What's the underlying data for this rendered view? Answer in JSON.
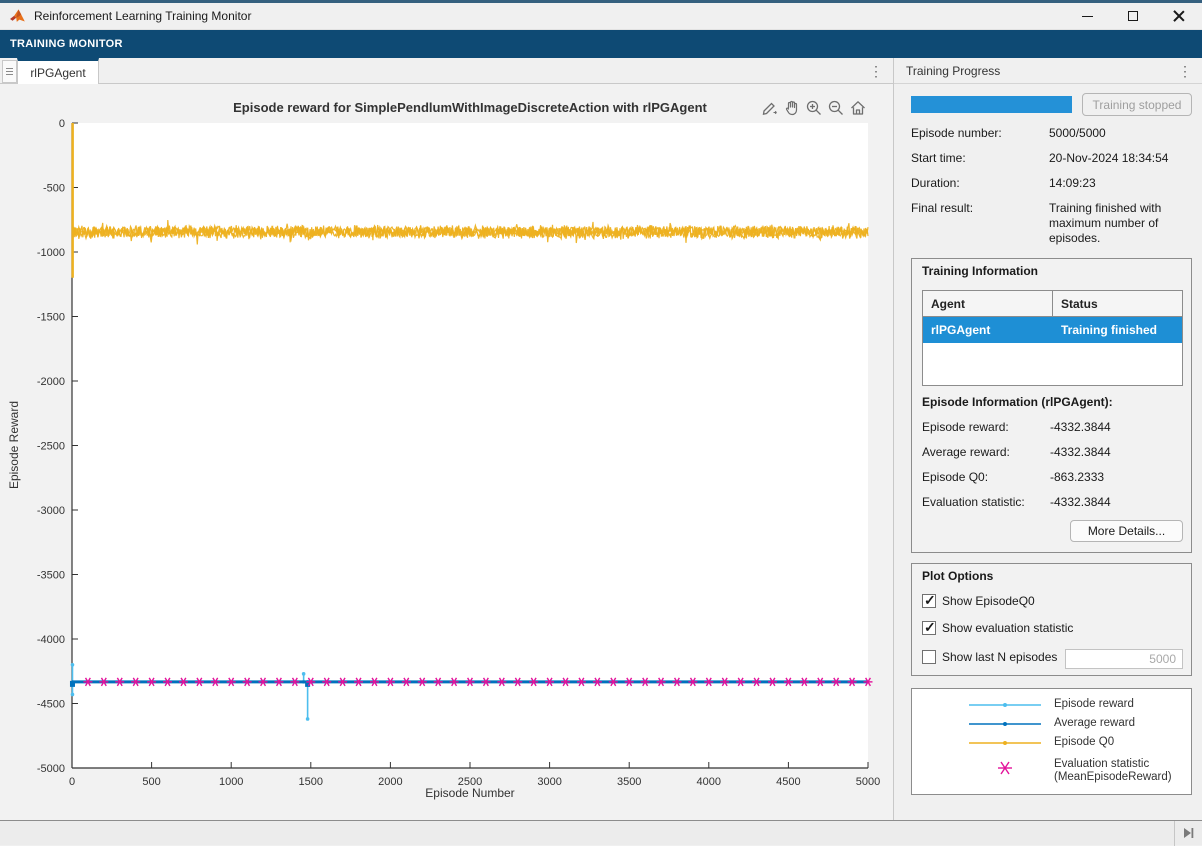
{
  "window": {
    "title": "Reinforcement Learning Training Monitor"
  },
  "toolstrip": {
    "tab_label": "TRAINING MONITOR"
  },
  "doc_tab": {
    "label": "rlPGAgent"
  },
  "colors": {
    "toolstrip_blue": "#0e4a74",
    "selection_blue": "#1e8fd5",
    "progress_blue": "#2491d7",
    "episode_reward": "#4DBEEE",
    "average_reward": "#0072BD",
    "episode_q0": "#EDB120",
    "evaluation_statistic": "#E3129B"
  },
  "panel": {
    "title": "Training Progress",
    "progress": {
      "percent": 100,
      "button_label": "Training stopped"
    },
    "rows": [
      {
        "label": "Episode number:",
        "value": "5000/5000"
      },
      {
        "label": "Start time:",
        "value": "20-Nov-2024 18:34:54"
      },
      {
        "label": "Duration:",
        "value": "14:09:23"
      },
      {
        "label": "Final result:",
        "value": "Training finished with maximum number of episodes."
      }
    ],
    "training_information": {
      "title": "Training Information",
      "table": {
        "headers": [
          "Agent",
          "Status"
        ],
        "rows": [
          {
            "agent": "rlPGAgent",
            "status": "Training finished",
            "selected": true
          }
        ]
      },
      "episode_info_title": "Episode Information (rlPGAgent):",
      "rows": [
        {
          "label": "Episode reward:",
          "value": "-4332.3844"
        },
        {
          "label": "Average reward:",
          "value": "-4332.3844"
        },
        {
          "label": "Episode Q0:",
          "value": "-863.2333"
        },
        {
          "label": "Evaluation statistic:",
          "value": "-4332.3844"
        }
      ],
      "more_details_label": "More Details..."
    },
    "plot_options": {
      "title": "Plot Options",
      "items": [
        {
          "label": "Show EpisodeQ0",
          "checked": true
        },
        {
          "label": "Show evaluation statistic",
          "checked": true
        },
        {
          "label": "Show last N episodes",
          "checked": false
        }
      ],
      "n_episodes_value": "5000"
    },
    "legend": {
      "items": [
        {
          "label": "Episode reward",
          "label2": "",
          "color": "#4DBEEE",
          "marker": "line-dot"
        },
        {
          "label": "Average reward",
          "label2": "",
          "color": "#0072BD",
          "marker": "line-dot"
        },
        {
          "label": "Episode Q0",
          "label2": "",
          "color": "#EDB120",
          "marker": "line-dot"
        },
        {
          "label": "Evaluation statistic",
          "label2": "(MeanEpisodeReward)",
          "color": "#E3129B",
          "marker": "asterisk"
        }
      ]
    }
  },
  "chart_data": {
    "type": "line",
    "title": "Episode reward for SimplePendlumWithImageDiscreteAction with rlPGAgent",
    "xlabel": "Episode Number",
    "ylabel": "Episode Reward",
    "xlim": [
      0,
      5000
    ],
    "ylim": [
      -5000,
      0
    ],
    "xticks": [
      0,
      500,
      1000,
      1500,
      2000,
      2500,
      3000,
      3500,
      4000,
      4500,
      5000
    ],
    "yticks": [
      0,
      -500,
      -1000,
      -1500,
      -2000,
      -2500,
      -3000,
      -3500,
      -4000,
      -4500,
      -5000
    ],
    "grid": false,
    "legend_position": "outside-right-panel",
    "series": [
      {
        "name": "Episode Q0",
        "type": "noisy_line",
        "color": "#EDB120",
        "mean": -845,
        "noise_halfwidth": 55,
        "initial_transient": {
          "episode": 4,
          "min": -1200,
          "max": 0
        },
        "episode_range": [
          0,
          5000
        ]
      },
      {
        "name": "Episode reward",
        "type": "line",
        "color": "#4DBEEE",
        "constant_value": -4332.3844,
        "anomalies": [
          {
            "episode": 3,
            "min": -4430,
            "max": -4200
          },
          {
            "episode": 1455,
            "min": -4332,
            "max": -4270
          },
          {
            "episode": 1480,
            "min": -4620,
            "max": -4332
          }
        ]
      },
      {
        "name": "Average reward",
        "type": "line",
        "color": "#0072BD",
        "constant_value": -4332.3844,
        "square_markers_at": [
          3,
          1480
        ]
      },
      {
        "name": "Evaluation statistic (MeanEpisodeReward)",
        "type": "markers",
        "marker": "asterisk",
        "color": "#E3129B",
        "value": -4332.3844,
        "episode_interval": 100,
        "episode_range": [
          100,
          5000
        ]
      }
    ]
  },
  "statusbar": {}
}
